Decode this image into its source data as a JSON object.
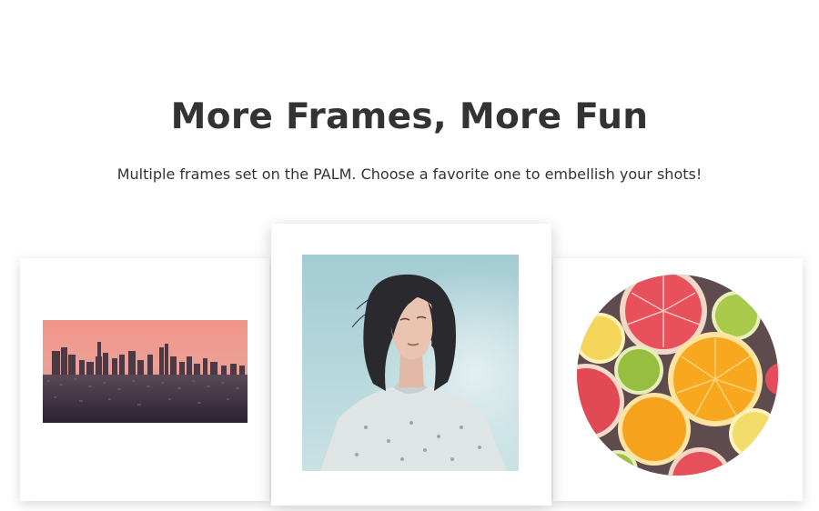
{
  "hero": {
    "title": "More Frames, More Fun",
    "subtitle": "Multiple frames set on the PALM. Choose a favorite one to embellish your shots!"
  },
  "frames": [
    {
      "name": "rectangle-frame",
      "photo": "city-skyline-photo"
    },
    {
      "name": "square-frame",
      "photo": "woman-portrait-photo"
    },
    {
      "name": "circle-frame",
      "photo": "citrus-fruits-photo"
    }
  ],
  "colors": {
    "title": "#333333",
    "text": "#333333",
    "background": "#ffffff",
    "sky_top": "#f4968c",
    "sky_bottom": "#e8a39a",
    "portrait_sky": "#a9d0d6"
  }
}
